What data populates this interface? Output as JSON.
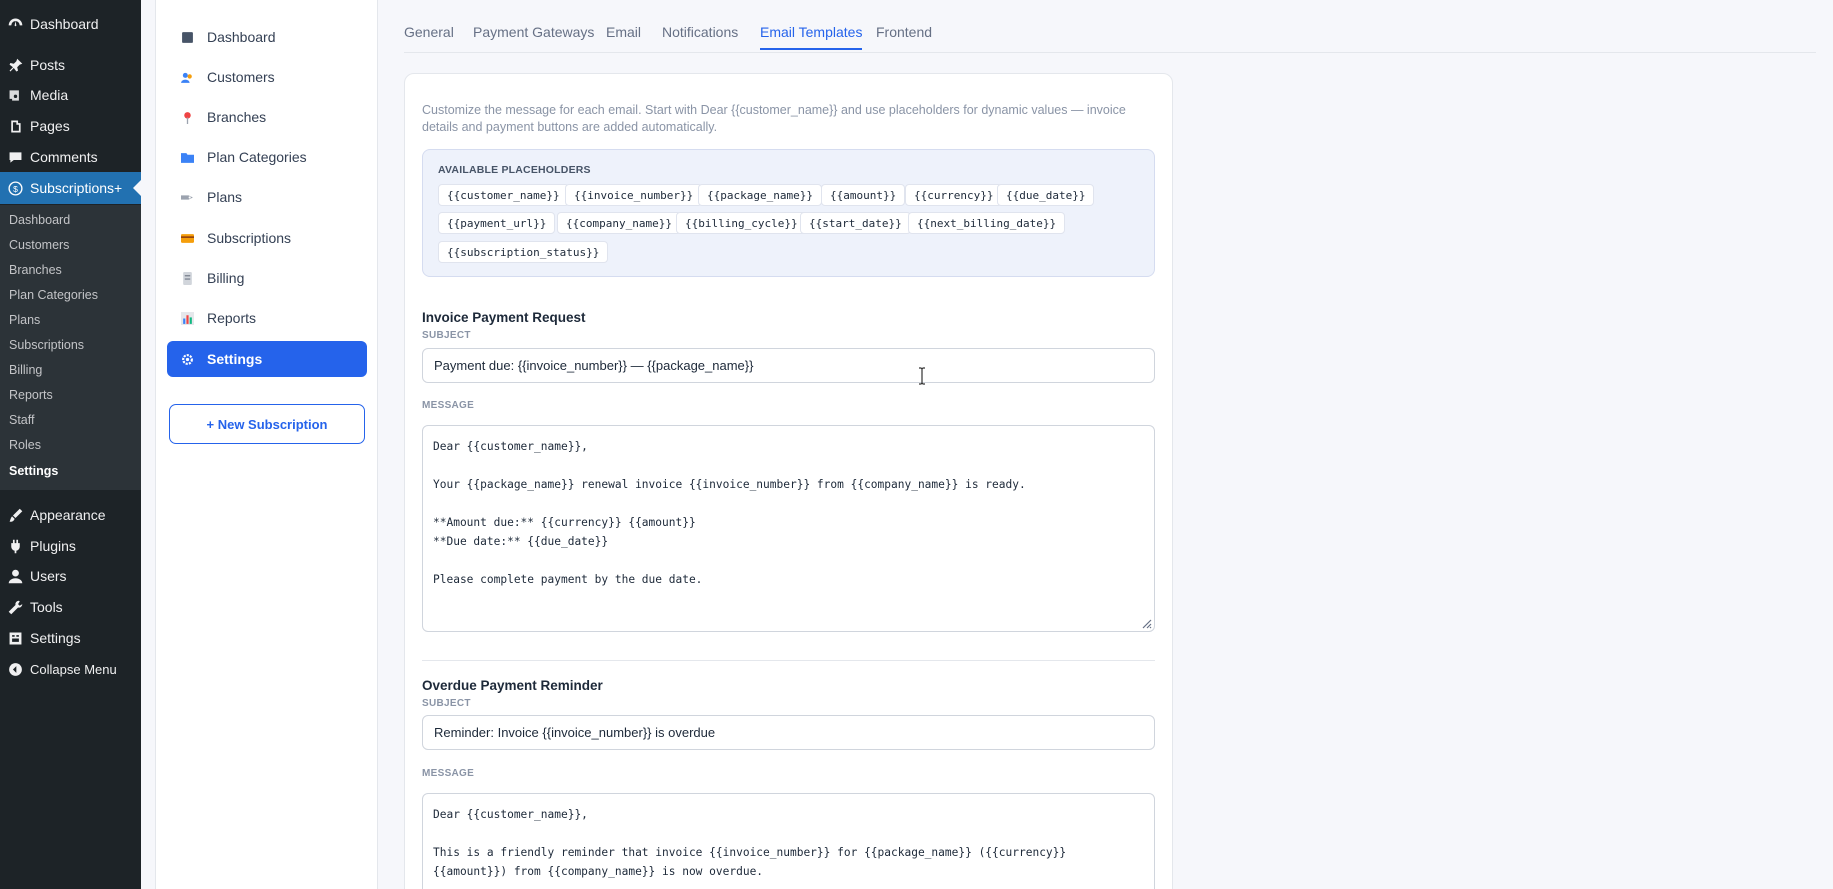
{
  "wp_menu": {
    "items": [
      {
        "label": "Dashboard",
        "icon": "dashboard-icon"
      },
      {
        "label": "Posts",
        "icon": "pin-icon"
      },
      {
        "label": "Media",
        "icon": "media-icon"
      },
      {
        "label": "Pages",
        "icon": "pages-icon"
      },
      {
        "label": "Comments",
        "icon": "comments-icon"
      },
      {
        "label": "Subscriptions+",
        "icon": "dollar-icon"
      },
      {
        "label": "Appearance",
        "icon": "brush-icon"
      },
      {
        "label": "Plugins",
        "icon": "plug-icon"
      },
      {
        "label": "Users",
        "icon": "user-icon"
      },
      {
        "label": "Tools",
        "icon": "wrench-icon"
      },
      {
        "label": "Settings",
        "icon": "settings-icon"
      },
      {
        "label": "Collapse Menu",
        "icon": "collapse-icon"
      }
    ],
    "submenu": [
      "Dashboard",
      "Customers",
      "Branches",
      "Plan Categories",
      "Plans",
      "Subscriptions",
      "Billing",
      "Reports",
      "Staff",
      "Roles",
      "Settings"
    ]
  },
  "plugin_nav": {
    "items": [
      {
        "label": "Dashboard",
        "icon": "square-icon"
      },
      {
        "label": "Customers",
        "icon": "people-icon"
      },
      {
        "label": "Branches",
        "icon": "pin-icon"
      },
      {
        "label": "Plan Categories",
        "icon": "folder-icon"
      },
      {
        "label": "Plans",
        "icon": "tag-icon"
      },
      {
        "label": "Subscriptions",
        "icon": "card-icon"
      },
      {
        "label": "Billing",
        "icon": "receipt-icon"
      },
      {
        "label": "Reports",
        "icon": "bar-chart-icon"
      },
      {
        "label": "Settings",
        "icon": "gear-icon"
      }
    ],
    "new_button": "+ New Subscription"
  },
  "tabs": [
    "General",
    "Payment Gateways",
    "Email",
    "Notifications",
    "Email Templates",
    "Frontend"
  ],
  "active_tab": "Email Templates",
  "intro": "Customize the message for each email. Start with Dear {{customer_name}} and use placeholders for dynamic values — invoice details and payment buttons are added automatically.",
  "placeholders": {
    "title": "AVAILABLE PLACEHOLDERS",
    "chips": [
      "{{customer_name}}",
      "{{invoice_number}}",
      "{{package_name}}",
      "{{amount}}",
      "{{currency}}",
      "{{due_date}}",
      "{{payment_url}}",
      "{{company_name}}",
      "{{billing_cycle}}",
      "{{start_date}}",
      "{{next_billing_date}}",
      "{{subscription_status}}"
    ]
  },
  "templates": [
    {
      "title": "Invoice Payment Request",
      "subject_label": "SUBJECT",
      "subject": "Payment due: {{invoice_number}} — {{package_name}}",
      "message_label": "MESSAGE",
      "message_lines": [
        "Dear {{customer_name}},",
        "",
        "Your {{package_name}} renewal invoice {{invoice_number}} from {{company_name}} is ready.",
        "",
        "**Amount due:** {{currency}} {{amount}}",
        "**Due date:** {{due_date}}",
        "",
        "Please complete payment by the due date."
      ]
    },
    {
      "title": "Overdue Payment Reminder",
      "subject_label": "SUBJECT",
      "subject": "Reminder: Invoice {{invoice_number}} is overdue",
      "message_label": "MESSAGE",
      "message_lines": [
        "Dear {{customer_name}},",
        "",
        "This is a friendly reminder that invoice {{invoice_number}} for {{package_name}} ({{currency}}",
        "{{amount}}) from {{company_name}} is now overdue."
      ]
    }
  ],
  "colors": {
    "accent": "#2563eb",
    "wp_sidebar": "#1d2327",
    "wp_active": "#2271b1"
  }
}
